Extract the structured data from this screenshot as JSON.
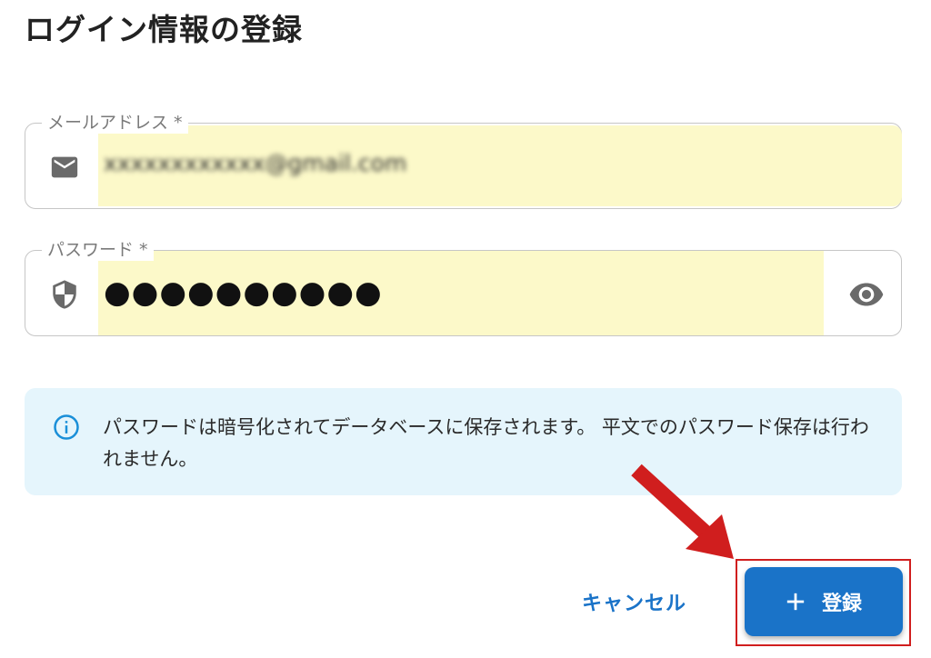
{
  "page": {
    "title": "ログイン情報の登録"
  },
  "email_field": {
    "label": "メールアドレス *",
    "value": "xxxxxxxxxxxx@gmail.com",
    "icon": "mail-icon"
  },
  "password_field": {
    "label": "パスワード *",
    "value": "●●●●●●●●●●",
    "icon": "shield-icon",
    "toggle_icon": "eye-icon"
  },
  "info": {
    "icon": "info-icon",
    "text": "パスワードは暗号化されてデータベースに保存されます。 平文でのパスワード保存は行われません。"
  },
  "actions": {
    "cancel_label": "キャンセル",
    "register_label": "登録",
    "register_icon": "plus-icon"
  },
  "colors": {
    "accent": "#1a73c8",
    "autofill": "#fcf9c9",
    "info_bg": "#e5f5fc",
    "annotation": "#d01e1e"
  }
}
